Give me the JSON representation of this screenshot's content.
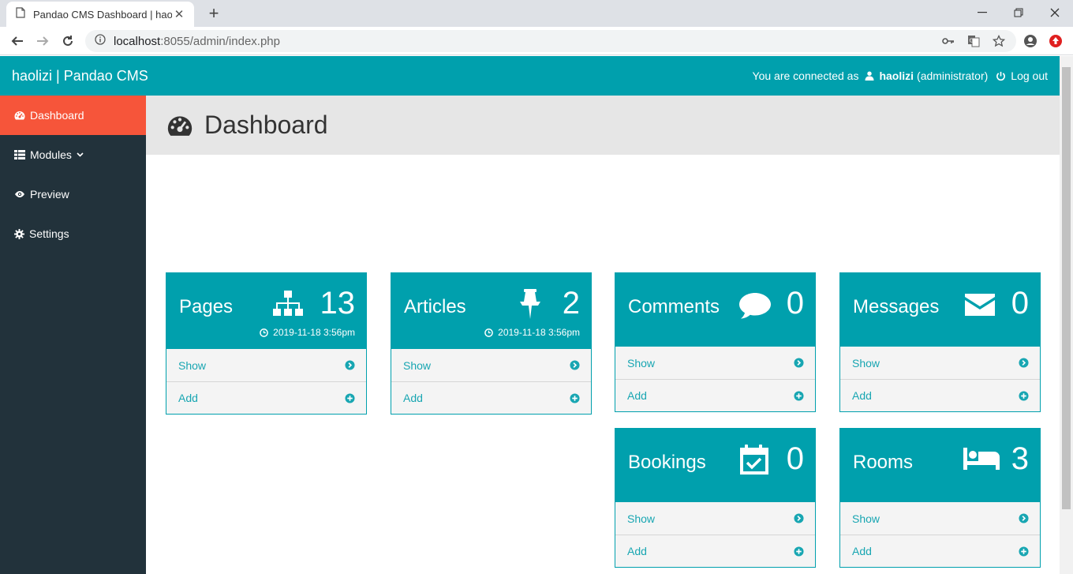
{
  "browser": {
    "tab_title": "Pandao CMS Dashboard | haolizi",
    "url_host": "localhost",
    "url_rest": ":8055/admin/index.php"
  },
  "header": {
    "brand": "haolizi | Pandao CMS",
    "connected_label": "You are connected as",
    "username": "haolizi",
    "role": "(administrator)",
    "logout_label": "Log out"
  },
  "sidebar": {
    "items": [
      {
        "label": "Dashboard",
        "icon": "dashboard-icon",
        "active": true
      },
      {
        "label": "Modules",
        "icon": "grid-icon",
        "active": false
      },
      {
        "label": "Preview",
        "icon": "eye-icon",
        "active": false
      },
      {
        "label": "Settings",
        "icon": "gear-icon",
        "active": false
      }
    ]
  },
  "page": {
    "title": "Dashboard"
  },
  "cards": [
    {
      "name": "Pages",
      "count": "13",
      "date": "2019-11-18 3:56pm",
      "show": "Show",
      "add": "Add",
      "icon": "sitemap-icon"
    },
    {
      "name": "Articles",
      "count": "2",
      "date": "2019-11-18 3:56pm",
      "show": "Show",
      "add": "Add",
      "icon": "pin-icon"
    },
    {
      "name": "Comments",
      "count": "0",
      "show": "Show",
      "add": "Add",
      "icon": "comment-icon"
    },
    {
      "name": "Messages",
      "count": "0",
      "show": "Show",
      "add": "Add",
      "icon": "envelope-icon"
    },
    {
      "name": "Bookings",
      "count": "0",
      "show": "Show",
      "add": "Add",
      "icon": "calendar-check-icon"
    },
    {
      "name": "Rooms",
      "count": "3",
      "show": "Show",
      "add": "Add",
      "icon": "bed-icon"
    }
  ],
  "colors": {
    "teal": "#00a0ad",
    "sidebar_bg": "#22323b",
    "active_red": "#f6553a",
    "page_head_bg": "#e6e6e6"
  }
}
